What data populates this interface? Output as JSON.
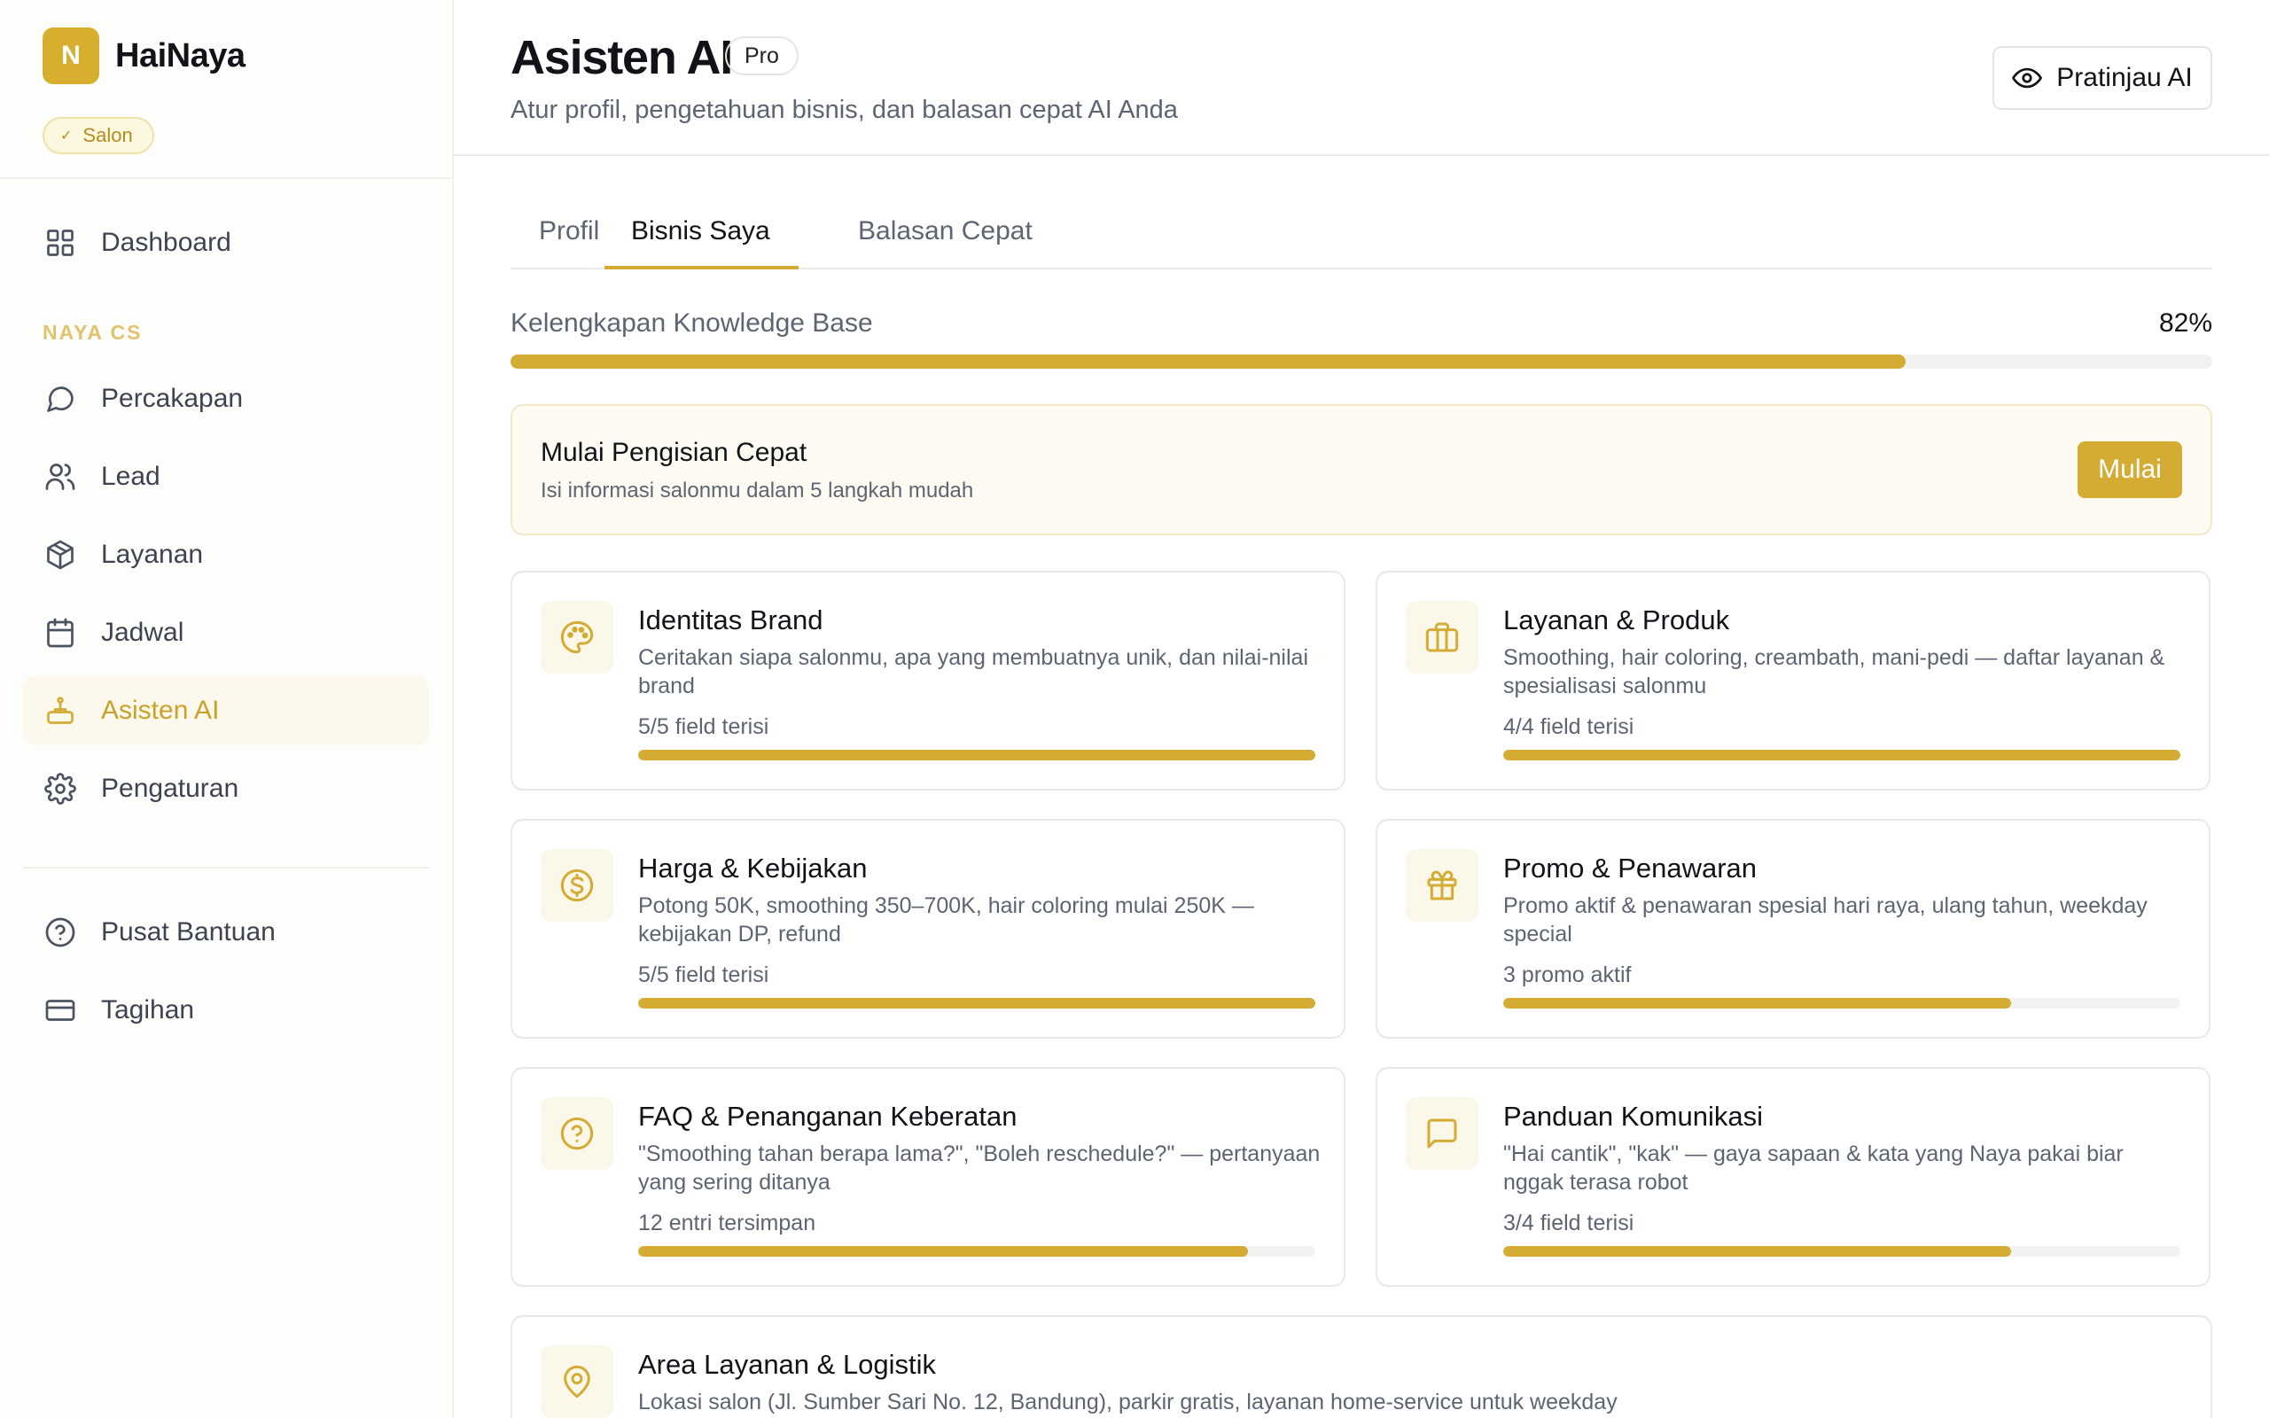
{
  "app": {
    "logo_letter": "N",
    "name": "HaiNaya",
    "category_badge": "Salon"
  },
  "sidebar": {
    "top_items": [
      {
        "label": "Dashboard",
        "icon": "grid-icon"
      }
    ],
    "section_label": "NAYA CS",
    "items": [
      {
        "label": "Percakapan",
        "icon": "chat-icon"
      },
      {
        "label": "Lead",
        "icon": "users-icon"
      },
      {
        "label": "Layanan",
        "icon": "box-icon"
      },
      {
        "label": "Jadwal",
        "icon": "calendar-icon"
      },
      {
        "label": "Asisten AI",
        "icon": "bot-icon",
        "active": true
      },
      {
        "label": "Pengaturan",
        "icon": "gear-icon"
      }
    ],
    "bottom_items": [
      {
        "label": "Pusat Bantuan",
        "icon": "help-circle-icon"
      },
      {
        "label": "Tagihan",
        "icon": "credit-card-icon"
      }
    ]
  },
  "header": {
    "title": "Asisten AI",
    "plan_badge": "Pro",
    "subtitle": "Atur profil, pengetahuan bisnis, dan balasan cepat AI Anda",
    "preview_button": "Pratinjau AI"
  },
  "tabs": [
    {
      "label": "Profil"
    },
    {
      "label": "Bisnis Saya",
      "active": true
    },
    {
      "label": "Balasan Cepat"
    }
  ],
  "knowledge_base": {
    "label": "Kelengkapan Knowledge Base",
    "percent_label": "82%",
    "percent": 82
  },
  "quick_start": {
    "title": "Mulai Pengisian Cepat",
    "subtitle": "Isi informasi salonmu dalam 5 langkah mudah",
    "button": "Mulai"
  },
  "cards": [
    {
      "title": "Identitas Brand",
      "desc": "Ceritakan siapa salonmu, apa yang membuatnya unik, dan nilai-nilai brand",
      "stat": "5/5 field terisi",
      "progress": 100,
      "icon": "palette-icon"
    },
    {
      "title": "Layanan & Produk",
      "desc": "Smoothing, hair coloring, creambath, mani-pedi — daftar layanan & spesialisasi salonmu",
      "stat": "4/4 field terisi",
      "progress": 100,
      "icon": "briefcase-icon"
    },
    {
      "title": "Harga & Kebijakan",
      "desc": "Potong 50K, smoothing 350–700K, hair coloring mulai 250K — kebijakan DP, refund",
      "stat": "5/5 field terisi",
      "progress": 100,
      "icon": "dollar-circle-icon"
    },
    {
      "title": "Promo & Penawaran",
      "desc": "Promo aktif & penawaran spesial hari raya, ulang tahun, weekday special",
      "stat": "3 promo aktif",
      "progress": 75,
      "icon": "gift-icon"
    },
    {
      "title": "FAQ & Penanganan Keberatan",
      "desc": "\"Smoothing tahan berapa lama?\", \"Boleh reschedule?\" — pertanyaan yang sering ditanya",
      "stat": "12 entri tersimpan",
      "progress": 90,
      "icon": "question-circle-icon"
    },
    {
      "title": "Panduan Komunikasi",
      "desc": "\"Hai cantik\", \"kak\" — gaya sapaan & kata yang Naya pakai biar nggak terasa robot",
      "stat": "3/4 field terisi",
      "progress": 75,
      "icon": "message-square-icon"
    },
    {
      "title": "Area Layanan & Logistik",
      "desc": "Lokasi salon (Jl. Sumber Sari No. 12, Bandung), parkir gratis, layanan home-service untuk weekday",
      "icon": "map-pin-icon"
    }
  ],
  "colors": {
    "accent": "#d4ab33",
    "accent_soft": "#fcf9ec",
    "text": "#111318",
    "muted": "#5d6472"
  }
}
